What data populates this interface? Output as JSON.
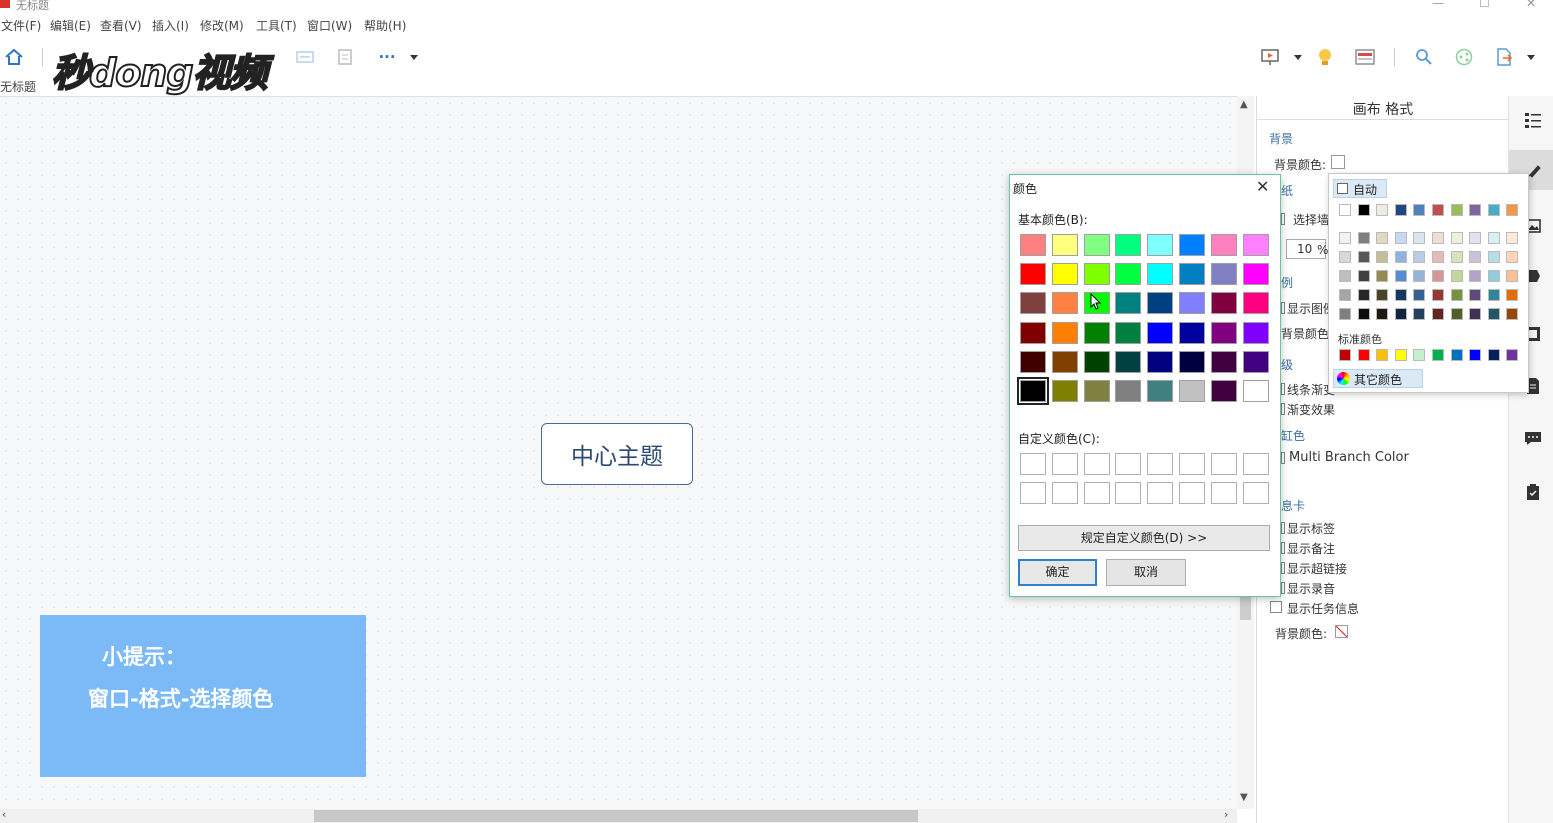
{
  "window": {
    "title": "无标题",
    "controls": {
      "minimize": "—",
      "maximize": "☐",
      "close": "✕"
    }
  },
  "menubar": {
    "items": [
      "文件(F)",
      "编辑(E)",
      "查看(V)",
      "插入(I)",
      "修改(M)",
      "工具(T)",
      "窗口(W)",
      "帮助(H)"
    ]
  },
  "toolbar": {
    "more_label": "···",
    "left_icons": [
      "home-icon",
      "topic-icon",
      "subtopic-icon"
    ],
    "right_icons": [
      "presentation-icon",
      "idea-icon",
      "outline-icon",
      "search-icon",
      "share-icon",
      "export-icon"
    ]
  },
  "watermark": {
    "text": "秒dong视频"
  },
  "document_tab": {
    "label": "无标题"
  },
  "canvas": {
    "central_topic": "中心主题",
    "tip_title": "小提示：",
    "tip_body": "窗口-格式-选择颜色",
    "tip_color": "#7bbaf7"
  },
  "right_panel": {
    "title": "画布 格式",
    "background_section": "背景",
    "background_color_label": "背景颜色:",
    "wallpaper_label": "纸",
    "select_wallpaper_label": "选择墙",
    "opacity_value": "10",
    "opacity_unit": "%",
    "legend_section": "例",
    "show_legend_label": "显示图例",
    "legend_bg_label": "背景颜色:",
    "advanced_section": "级",
    "gradient_line_label": "线条渐变",
    "gradient_effect_label": "渐变效果",
    "color_section": "缸色",
    "multi_branch_label": "Multi Branch Color",
    "info_card_section": "息卡",
    "show_labels": "显示标签",
    "show_notes": "显示备注",
    "show_hyperlinks": "显示超链接",
    "show_audio": "显示录音",
    "show_task_info": "显示任务信息",
    "card_bg_label": "背景颜色:"
  },
  "right_bar": {
    "icons": [
      "format-panel-icon",
      "brush-icon",
      "image-icon",
      "marker-icon",
      "clipart-icon",
      "notes-icon",
      "comment-icon",
      "task-icon"
    ]
  },
  "color_dialog": {
    "title": "颜色",
    "close_label": "✕",
    "basic_colors_label": "基本颜色(B):",
    "custom_colors_label": "自定义颜色(C):",
    "define_custom_button": "规定自定义颜色(D) >>",
    "ok_button": "确定",
    "cancel_button": "取消",
    "basic_colors": [
      [
        "#ff8080",
        "#ffff80",
        "#80ff80",
        "#00ff80",
        "#80ffff",
        "#0080ff",
        "#ff80c0",
        "#ff80ff"
      ],
      [
        "#ff0000",
        "#ffff00",
        "#80ff00",
        "#00ff40",
        "#00ffff",
        "#0080c0",
        "#8080c0",
        "#ff00ff"
      ],
      [
        "#804040",
        "#ff8040",
        "#00ff00",
        "#008080",
        "#004080",
        "#8080ff",
        "#800040",
        "#ff0080"
      ],
      [
        "#800000",
        "#ff8000",
        "#008000",
        "#008040",
        "#0000ff",
        "#0000a0",
        "#800080",
        "#8000ff"
      ],
      [
        "#400000",
        "#804000",
        "#004000",
        "#004040",
        "#000080",
        "#000040",
        "#400040",
        "#400080"
      ],
      [
        "#000000",
        "#808000",
        "#808040",
        "#808080",
        "#408080",
        "#c0c0c0",
        "#400040",
        "#ffffff"
      ]
    ],
    "selected_index": [
      5,
      0
    ]
  },
  "color_popup": {
    "auto_label": "自动",
    "theme_top_row": [
      "#ffffff",
      "#000000",
      "#eeece1",
      "#1f497d",
      "#4f81bd",
      "#c0504d",
      "#9bbb59",
      "#8064a2",
      "#4bacc6",
      "#f79646"
    ],
    "theme_shades": [
      [
        "#f2f2f2",
        "#7f7f7f",
        "#ddd9c3",
        "#c6d9f0",
        "#dbe5f1",
        "#f2dcdb",
        "#ebf1dd",
        "#e5e0ec",
        "#dbeef3",
        "#fdeada"
      ],
      [
        "#d8d8d8",
        "#595959",
        "#c4bd97",
        "#8db3e2",
        "#b8cce4",
        "#e5b9b7",
        "#d7e3bc",
        "#ccc1d9",
        "#b7dde8",
        "#fbd5b5"
      ],
      [
        "#bfbfbf",
        "#3f3f3f",
        "#938953",
        "#548dd4",
        "#95b3d7",
        "#d99694",
        "#c3d69b",
        "#b2a2c7",
        "#92cddc",
        "#fac08f"
      ],
      [
        "#a5a5a5",
        "#262626",
        "#494429",
        "#17365d",
        "#366092",
        "#953734",
        "#76923c",
        "#5f497a",
        "#31859b",
        "#e36c09"
      ],
      [
        "#7f7f7f",
        "#0c0c0c",
        "#1d1b10",
        "#0f243e",
        "#244061",
        "#632423",
        "#4f6128",
        "#3f3151",
        "#205867",
        "#974806"
      ]
    ],
    "standard_label": "标准颜色",
    "standard_colors": [
      "#c00000",
      "#ff0000",
      "#ffc000",
      "#ffff00",
      "#c6efce",
      "#00b050",
      "#0070c0",
      "#0000ff",
      "#002060",
      "#7030a0"
    ],
    "more_colors_label": "其它颜色"
  }
}
